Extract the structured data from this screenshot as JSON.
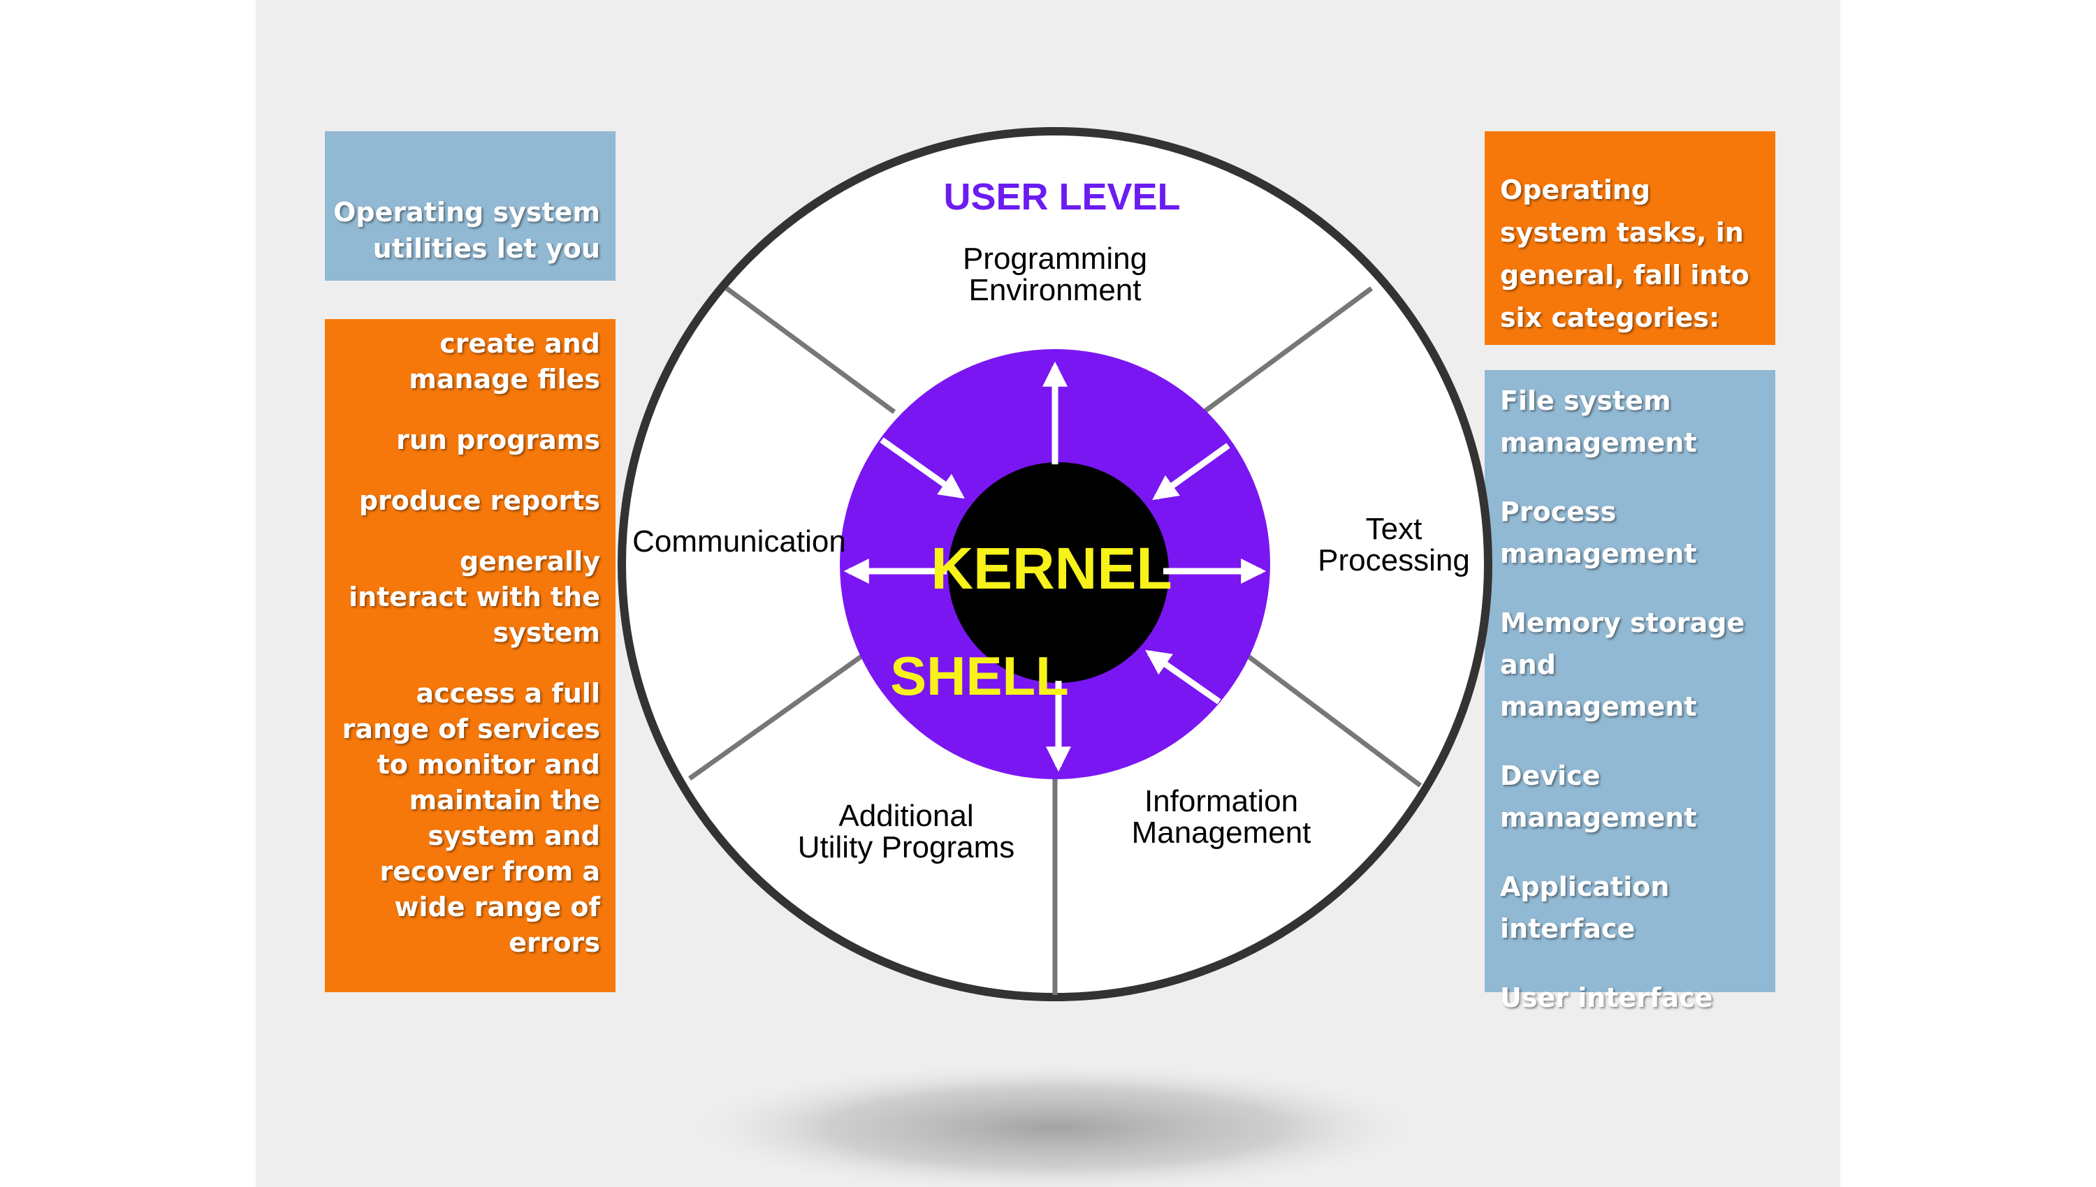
{
  "left_panel": {
    "title": "Operating system utilities let you",
    "items": [
      "create and manage files",
      "run programs",
      "produce reports",
      "generally interact with the system",
      "access a full range of services to monitor and maintain the system and recover from a wide range of errors"
    ]
  },
  "right_panel": {
    "title": "Operating system tasks, in general, fall into six categories:",
    "items": [
      "File system management",
      "Process management",
      "Memory storage and management",
      "Device management",
      "Application interface",
      "User interface"
    ]
  },
  "diagram": {
    "user_level": "USER LEVEL",
    "kernel": "KERNEL",
    "shell": "SHELL",
    "sectors": {
      "programming_line1": "Programming",
      "programming_line2": "Environment",
      "text_line1": "Text",
      "text_line2": "Processing",
      "information_line1": "Information",
      "information_line2": "Management",
      "utility_line1": "Additional",
      "utility_line2": "Utility Programs",
      "communication": "Communication"
    },
    "colors": {
      "shell": "#7a16f2",
      "kernel": "#000000",
      "kernel_text": "#f7f21a",
      "user_level_text": "#6b1cf0",
      "blue_box": "#92b9d3",
      "orange_box": "#f7780a"
    }
  }
}
